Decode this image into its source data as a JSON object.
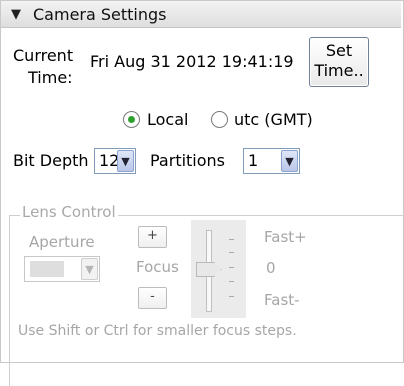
{
  "panel": {
    "title": "Camera Settings",
    "collapse_icon": "triangle-down-icon"
  },
  "time": {
    "label_line1": "Current",
    "label_line2": "Time:",
    "value": "Fri Aug 31 2012   19:41:19",
    "set_button_line1": "Set",
    "set_button_line2": "Time.."
  },
  "timezone": {
    "options": [
      {
        "label": "Local",
        "selected": true
      },
      {
        "label": "utc (GMT)",
        "selected": false
      }
    ]
  },
  "bit_depth": {
    "label": "Bit Depth",
    "value": "12"
  },
  "partitions": {
    "label": "Partitions",
    "value": "1"
  },
  "lens_control": {
    "group_label": "Lens Control",
    "aperture_label": "Aperture",
    "aperture_value": "",
    "plus_label": "+",
    "focus_label": "Focus",
    "minus_label": "-",
    "fast_plus": "Fast+",
    "zero": "0",
    "fast_minus": "Fast-"
  },
  "hint": "Use Shift or Ctrl for smaller focus steps."
}
